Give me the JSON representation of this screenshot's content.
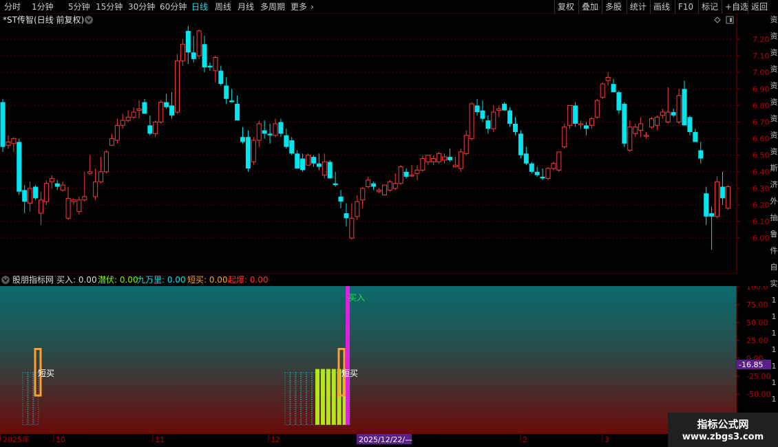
{
  "toolbar": {
    "periods": [
      "分时",
      "1分钟",
      "5分钟",
      "15分钟",
      "30分钟",
      "60分钟",
      "日线",
      "周线",
      "月线",
      "多周期",
      "更多"
    ],
    "active_period": "日线",
    "actions": [
      "复权",
      "叠加",
      "多股",
      "统计",
      "画线",
      "F10",
      "标记",
      "+自选",
      "返回"
    ]
  },
  "main_chart": {
    "stock_title": "*ST传智(日线 前复权)",
    "price_ticks": [
      "7.20",
      "7.10",
      "7.00",
      "6.90",
      "6.80",
      "6.70",
      "6.60",
      "6.50",
      "6.40",
      "6.30",
      "6.20",
      "6.10",
      "6.00"
    ],
    "ohlc": [
      [
        6.82,
        6.84,
        6.52,
        6.55
      ],
      [
        6.56,
        6.62,
        6.54,
        6.58
      ],
      [
        6.57,
        6.61,
        6.52,
        6.6
      ],
      [
        6.58,
        6.6,
        6.26,
        6.28
      ],
      [
        6.29,
        6.32,
        6.15,
        6.22
      ],
      [
        6.21,
        6.34,
        6.16,
        6.3
      ],
      [
        6.31,
        6.32,
        6.23,
        6.24
      ],
      [
        6.15,
        6.28,
        6.08,
        6.23
      ],
      [
        6.22,
        6.35,
        6.2,
        6.33
      ],
      [
        6.34,
        6.38,
        6.3,
        6.36
      ],
      [
        6.33,
        6.35,
        6.29,
        6.31
      ],
      [
        6.29,
        6.34,
        6.28,
        6.32
      ],
      [
        6.12,
        6.31,
        6.11,
        6.24
      ],
      [
        6.22,
        6.24,
        6.2,
        6.23
      ],
      [
        6.16,
        6.25,
        6.14,
        6.23
      ],
      [
        6.23,
        6.4,
        6.22,
        6.25
      ],
      [
        6.39,
        6.5,
        6.38,
        6.4
      ],
      [
        6.25,
        6.42,
        6.23,
        6.34
      ],
      [
        6.34,
        6.49,
        6.33,
        6.4
      ],
      [
        6.4,
        6.53,
        6.39,
        6.52
      ],
      [
        6.56,
        6.63,
        6.56,
        6.6
      ],
      [
        6.59,
        6.72,
        6.57,
        6.68
      ],
      [
        6.68,
        6.75,
        6.66,
        6.71
      ],
      [
        6.71,
        6.77,
        6.7,
        6.73
      ],
      [
        6.73,
        6.79,
        6.72,
        6.76
      ],
      [
        6.77,
        6.83,
        6.72,
        6.78
      ],
      [
        6.82,
        6.84,
        6.75,
        6.75
      ],
      [
        6.68,
        6.74,
        6.62,
        6.63
      ],
      [
        6.63,
        6.71,
        6.61,
        6.7
      ],
      [
        6.7,
        6.83,
        6.69,
        6.82
      ],
      [
        6.82,
        6.87,
        6.78,
        6.79
      ],
      [
        6.8,
        6.88,
        6.72,
        6.74
      ],
      [
        6.76,
        7.11,
        6.75,
        7.07
      ],
      [
        7.07,
        7.2,
        7.04,
        7.17
      ],
      [
        7.25,
        7.28,
        7.05,
        7.12
      ],
      [
        7.12,
        7.22,
        7.06,
        7.08
      ],
      [
        7.1,
        7.26,
        7.08,
        7.25
      ],
      [
        7.17,
        7.22,
        7.0,
        7.03
      ],
      [
        7.04,
        7.06,
        7.01,
        7.03
      ],
      [
        7.01,
        7.1,
        6.94,
        7.09
      ],
      [
        7.01,
        7.04,
        6.92,
        6.93
      ],
      [
        6.92,
        6.97,
        6.81,
        6.84
      ],
      [
        6.83,
        6.9,
        6.82,
        6.82
      ],
      [
        6.81,
        6.86,
        6.71,
        6.71
      ],
      [
        6.61,
        6.67,
        6.57,
        6.58
      ],
      [
        6.61,
        6.65,
        6.4,
        6.42
      ],
      [
        6.46,
        6.61,
        6.44,
        6.59
      ],
      [
        6.59,
        6.71,
        6.55,
        6.69
      ],
      [
        6.65,
        6.71,
        6.6,
        6.63
      ],
      [
        6.63,
        6.69,
        6.57,
        6.62
      ],
      [
        6.62,
        6.72,
        6.61,
        6.69
      ],
      [
        6.7,
        6.72,
        6.61,
        6.63
      ],
      [
        6.62,
        6.66,
        6.54,
        6.55
      ],
      [
        6.59,
        6.61,
        6.5,
        6.51
      ],
      [
        6.51,
        6.53,
        6.42,
        6.42
      ],
      [
        6.48,
        6.51,
        6.4,
        6.41
      ],
      [
        6.44,
        6.51,
        6.44,
        6.5
      ],
      [
        6.49,
        6.5,
        6.43,
        6.45
      ],
      [
        6.45,
        6.51,
        6.41,
        6.43
      ],
      [
        6.38,
        6.51,
        6.36,
        6.46
      ],
      [
        6.46,
        6.47,
        6.36,
        6.36
      ],
      [
        6.33,
        6.4,
        6.31,
        6.32
      ],
      [
        6.25,
        6.29,
        6.18,
        6.22
      ],
      [
        6.15,
        6.21,
        6.07,
        6.12
      ],
      [
        6.0,
        6.21,
        5.99,
        6.12
      ],
      [
        6.13,
        6.26,
        6.11,
        6.22
      ],
      [
        6.23,
        6.31,
        6.18,
        6.3
      ],
      [
        6.31,
        6.37,
        6.3,
        6.35
      ],
      [
        6.33,
        6.34,
        6.29,
        6.31
      ],
      [
        6.28,
        6.3,
        6.27,
        6.29
      ],
      [
        6.26,
        6.32,
        6.26,
        6.32
      ],
      [
        6.29,
        6.35,
        6.28,
        6.34
      ],
      [
        6.3,
        6.39,
        6.29,
        6.33
      ],
      [
        6.33,
        6.44,
        6.32,
        6.43
      ],
      [
        6.4,
        6.42,
        6.36,
        6.37
      ],
      [
        6.38,
        6.44,
        6.37,
        6.38
      ],
      [
        6.39,
        6.44,
        6.35,
        6.41
      ],
      [
        6.41,
        6.5,
        6.4,
        6.48
      ],
      [
        6.46,
        6.5,
        6.44,
        6.5
      ],
      [
        6.46,
        6.5,
        6.44,
        6.48
      ],
      [
        6.46,
        6.52,
        6.45,
        6.51
      ],
      [
        6.47,
        6.51,
        6.45,
        6.49
      ],
      [
        6.49,
        6.54,
        6.46,
        6.47
      ],
      [
        6.43,
        6.49,
        6.43,
        6.44
      ],
      [
        6.42,
        6.54,
        6.4,
        6.52
      ],
      [
        6.51,
        6.65,
        6.5,
        6.62
      ],
      [
        6.6,
        6.82,
        6.59,
        6.81
      ],
      [
        6.8,
        6.84,
        6.74,
        6.76
      ],
      [
        6.77,
        6.83,
        6.7,
        6.72
      ],
      [
        6.71,
        6.74,
        6.63,
        6.66
      ],
      [
        6.66,
        6.8,
        6.64,
        6.76
      ],
      [
        6.77,
        6.8,
        6.73,
        6.78
      ],
      [
        6.81,
        6.82,
        6.77,
        6.77
      ],
      [
        6.77,
        6.79,
        6.67,
        6.69
      ],
      [
        6.69,
        6.73,
        6.62,
        6.64
      ],
      [
        6.63,
        6.65,
        6.48,
        6.5
      ],
      [
        6.51,
        6.55,
        6.44,
        6.45
      ],
      [
        6.45,
        6.46,
        6.39,
        6.4
      ],
      [
        6.4,
        6.43,
        6.37,
        6.38
      ],
      [
        6.37,
        6.42,
        6.35,
        6.36
      ],
      [
        6.36,
        6.43,
        6.35,
        6.42
      ],
      [
        6.42,
        6.46,
        6.41,
        6.45
      ],
      [
        6.41,
        6.52,
        6.4,
        6.52
      ],
      [
        6.55,
        6.69,
        6.54,
        6.67
      ],
      [
        6.68,
        6.8,
        6.66,
        6.8
      ],
      [
        6.8,
        6.82,
        6.67,
        6.69
      ],
      [
        6.69,
        6.71,
        6.66,
        6.69
      ],
      [
        6.68,
        6.7,
        6.62,
        6.66
      ],
      [
        6.68,
        6.73,
        6.66,
        6.72
      ],
      [
        6.73,
        6.84,
        6.72,
        6.83
      ],
      [
        6.85,
        6.94,
        6.84,
        6.93
      ],
      [
        6.95,
        7.0,
        6.92,
        6.97
      ],
      [
        6.93,
        6.96,
        6.91,
        6.88
      ],
      [
        6.88,
        6.89,
        6.75,
        6.77
      ],
      [
        6.81,
        6.82,
        6.55,
        6.57
      ],
      [
        6.53,
        6.71,
        6.52,
        6.67
      ],
      [
        6.63,
        6.69,
        6.61,
        6.67
      ],
      [
        6.65,
        6.73,
        6.61,
        6.69
      ],
      [
        6.62,
        6.64,
        6.6,
        6.62
      ],
      [
        6.67,
        6.73,
        6.66,
        6.72
      ],
      [
        6.68,
        6.74,
        6.65,
        6.73
      ],
      [
        6.74,
        6.78,
        6.72,
        6.76
      ],
      [
        6.7,
        6.91,
        6.69,
        6.76
      ],
      [
        6.76,
        6.78,
        6.73,
        6.74
      ],
      [
        6.7,
        6.9,
        6.69,
        6.86
      ],
      [
        6.9,
        6.95,
        6.68,
        6.68
      ],
      [
        6.73,
        6.74,
        6.62,
        6.64
      ],
      [
        6.64,
        6.66,
        6.58,
        6.58
      ],
      [
        6.53,
        6.58,
        6.45,
        6.48
      ],
      [
        6.27,
        6.31,
        6.08,
        6.13
      ],
      [
        6.15,
        6.19,
        5.93,
        6.13
      ],
      [
        6.13,
        6.37,
        6.12,
        6.34
      ],
      [
        6.31,
        6.4,
        6.2,
        6.24
      ],
      [
        6.18,
        6.32,
        6.17,
        6.31
      ]
    ]
  },
  "sub_chart": {
    "indicator_name": "股朋指标网",
    "legend": [
      {
        "label": "买入: 0.00",
        "color": "#dcdcdc"
      },
      {
        "label": "潜伏: 0.00",
        "color": "#7cfc00"
      },
      {
        "label": "九万里: 0.00",
        "color": "#00e5ee"
      },
      {
        "label": "短买: 0.00",
        "color": "#ff9f2e"
      },
      {
        "label": "起爆: 0.00",
        "color": "#ff3030"
      }
    ],
    "y_ticks": [
      "100.0",
      "75.00",
      "50.00",
      "25.00",
      "0.00",
      "-25.00",
      "-50.00"
    ],
    "current_value": "-16.85",
    "buy_label": "买入",
    "short_buy_label": "短买"
  },
  "date_axis": {
    "labels": [
      "2025年",
      "10",
      "11",
      "12",
      "2",
      "3"
    ],
    "cursor_date": "2025/12/22/—"
  },
  "right_strip": [
    "资",
    "资",
    "资",
    "资",
    "资",
    "资",
    "资",
    "资",
    "资",
    "斯",
    "济",
    "外",
    "抽",
    "鲁",
    "件",
    "自",
    "实",
    "1",
    "1",
    "1",
    "1",
    "1",
    "1",
    "1",
    "1",
    "1"
  ],
  "watermark": {
    "title": "指标公式网",
    "url": "www.zbgs3.com"
  },
  "colors": {
    "up": "#ff3a3a",
    "down": "#00e5ee",
    "grid": "#5a0000",
    "bg_top": "#0a6b6e",
    "bg_bottom": "#6b0a0a",
    "buy_bar": "#e020e0",
    "short_buy_box": "#ff9f2e",
    "latent_bar": "#b4e61e"
  }
}
